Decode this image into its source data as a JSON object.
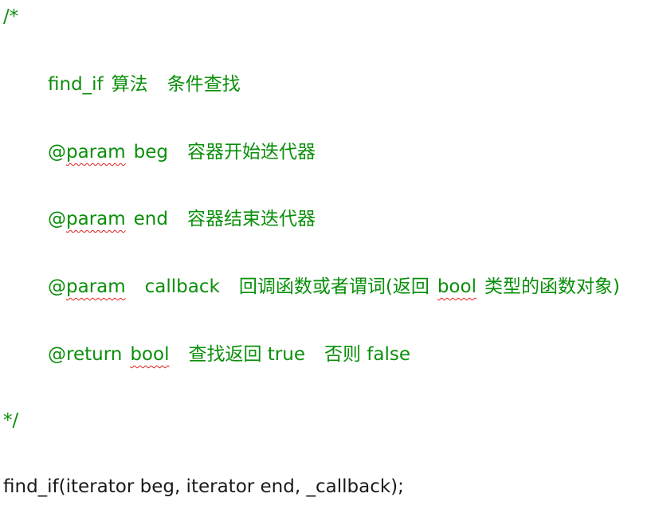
{
  "lines": {
    "comment_open": "/*",
    "line1": {
      "func": "find_if",
      "desc1": "算法",
      "desc2": "条件查找"
    },
    "line2": {
      "at": "@",
      "tag": "param",
      "name": "beg",
      "desc": "容器开始迭代器"
    },
    "line3": {
      "at": "@",
      "tag": "param",
      "name": "end",
      "desc": "容器结束迭代器"
    },
    "line4": {
      "at": "@",
      "tag": "param",
      "name": "callback",
      "desc_pre": "回调函数或者谓词(返回",
      "bool": "bool",
      "desc_post": "类型的函数对象)"
    },
    "line5": {
      "tag": "@return",
      "bool": "bool",
      "desc1": "查找返回 true",
      "desc2": "否则 false"
    },
    "comment_close": "*/",
    "code": "find_if(iterator beg, iterator end, _callback);"
  },
  "colors": {
    "comment": "#0a8f0a",
    "code": "#1a1a1a",
    "spellcheck": "#e02020"
  }
}
